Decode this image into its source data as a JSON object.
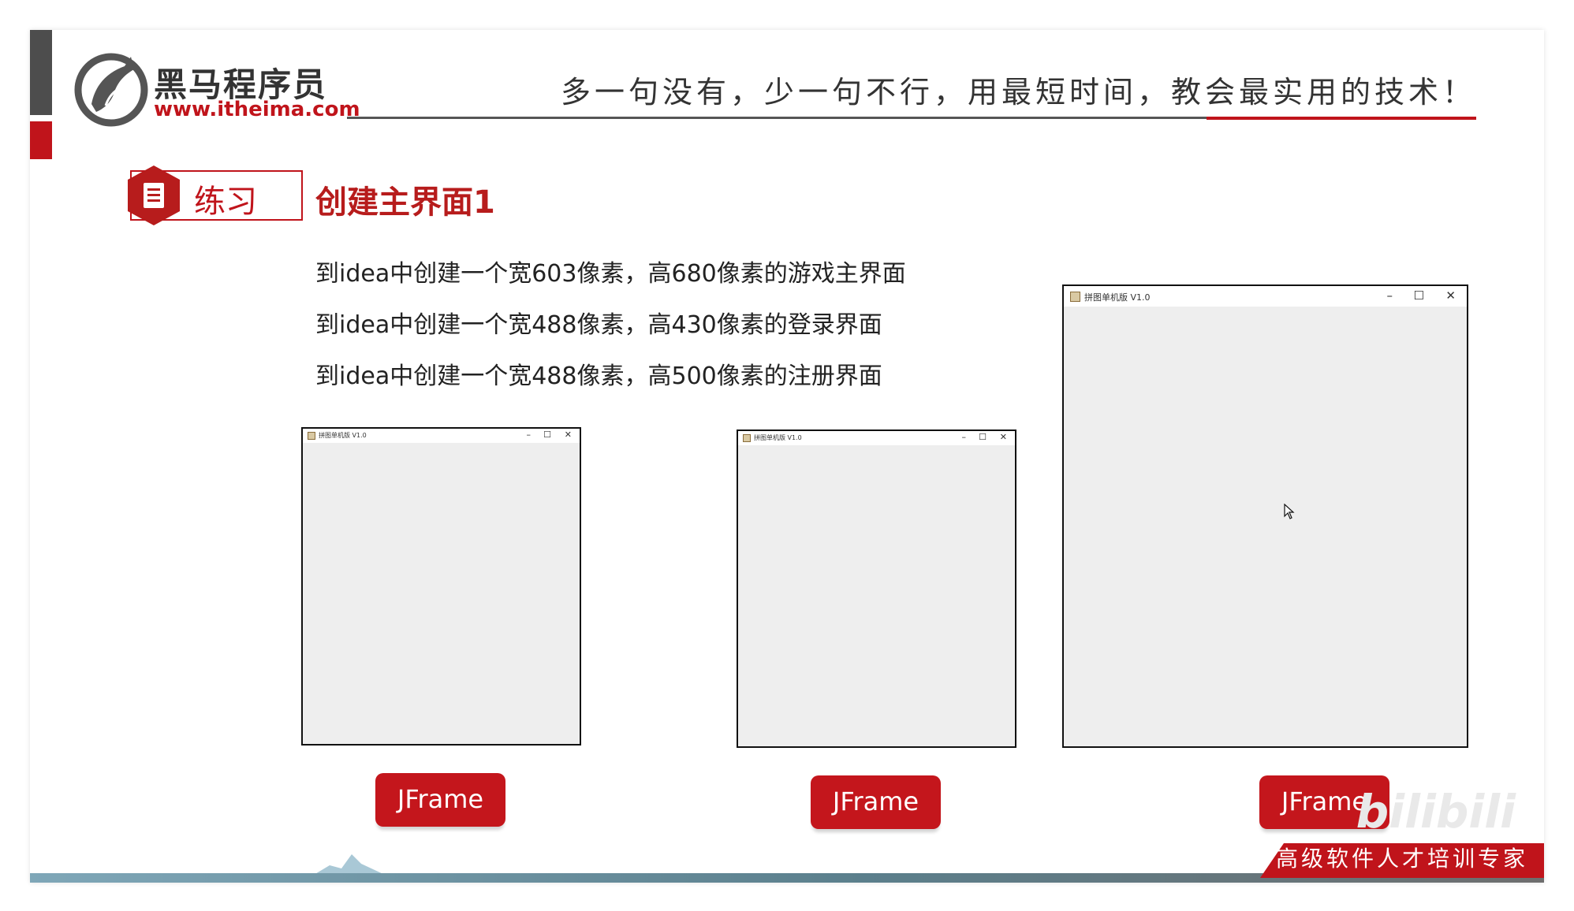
{
  "header": {
    "brand": "黑马程序员",
    "url": "www.itheima.com",
    "slogan": "多一句没有，少一句不行，用最短时间，教会最实用的技术！"
  },
  "exercise": {
    "tag": "练习",
    "heading": "创建主界面1"
  },
  "lines": [
    "到idea中创建一个宽603像素，高680像素的游戏主界面",
    "到idea中创建一个宽488像素，高430像素的登录界面",
    "到idea中创建一个宽488像素，高500像素的注册界面"
  ],
  "windows": [
    {
      "title": "拼图单机版 V1.0",
      "min": "–",
      "max": "☐",
      "close": "✕"
    },
    {
      "title": "拼图单机版 V1.0",
      "min": "–",
      "max": "☐",
      "close": "✕"
    },
    {
      "title": "拼图单机版 V1.0",
      "min": "–",
      "max": "☐",
      "close": "✕"
    }
  ],
  "buttons": [
    "JFrame",
    "JFrame",
    "JFrame"
  ],
  "footer": {
    "text": "高级软件人才培训专家",
    "watermark": "bilibili"
  },
  "colors": {
    "brand_red": "#c0141b",
    "button_red": "#c4161c",
    "frame_bg": "#eeeeee"
  }
}
